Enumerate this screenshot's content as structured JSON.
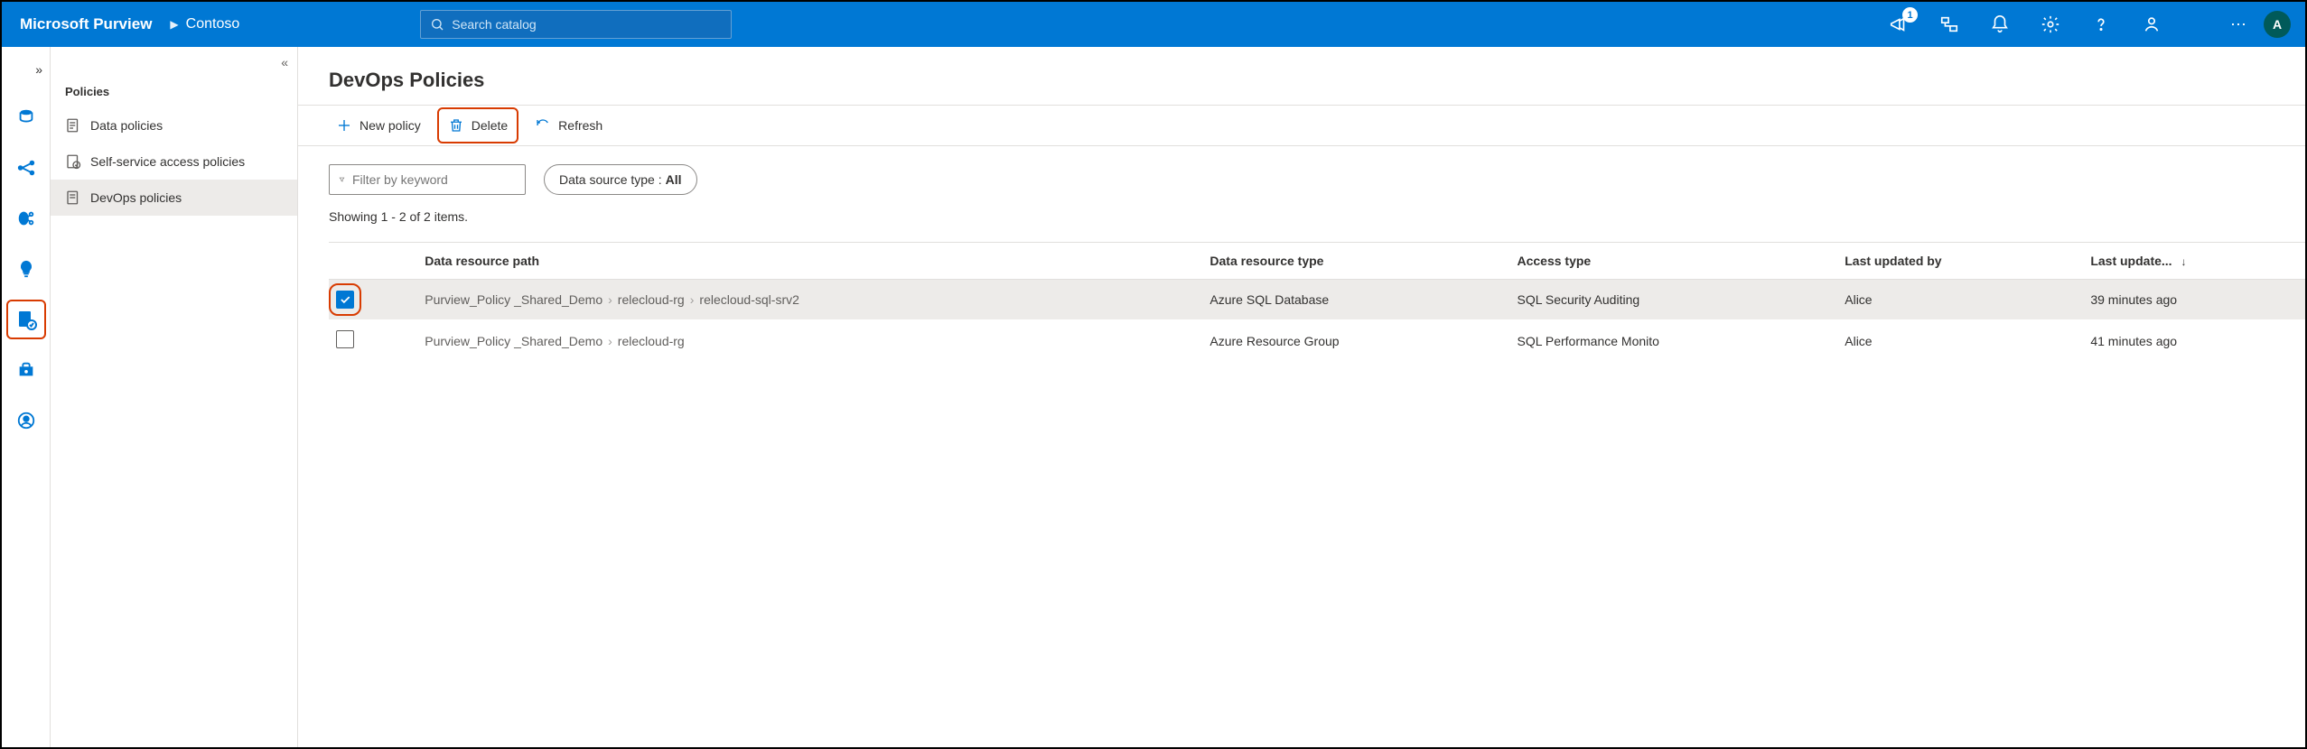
{
  "header": {
    "app_title": "Microsoft Purview",
    "breadcrumb": "Contoso",
    "search_placeholder": "Search catalog",
    "notification_count": "1",
    "avatar_initial": "A"
  },
  "sidebar": {
    "title": "Policies",
    "items": [
      {
        "label": "Data policies",
        "icon": "data-policies-icon"
      },
      {
        "label": "Self-service access policies",
        "icon": "self-service-icon"
      },
      {
        "label": "DevOps policies",
        "icon": "devops-policies-icon",
        "selected": true
      }
    ]
  },
  "page": {
    "title": "DevOps Policies",
    "commands": {
      "new_label": "New policy",
      "delete_label": "Delete",
      "refresh_label": "Refresh"
    },
    "filter_placeholder": "Filter by keyword",
    "source_type_label": "Data source type :",
    "source_type_value": "All",
    "count_line": "Showing 1 - 2 of 2 items.",
    "columns": {
      "path": "Data resource path",
      "type": "Data resource type",
      "access": "Access type",
      "user": "Last updated by",
      "updated": "Last update..."
    },
    "rows": [
      {
        "checked": true,
        "path": [
          "Purview_Policy _Shared_Demo",
          "relecloud-rg",
          "relecloud-sql-srv2"
        ],
        "type": "Azure SQL Database",
        "access": "SQL Security Auditing",
        "user": "Alice",
        "updated": "39 minutes ago"
      },
      {
        "checked": false,
        "path": [
          "Purview_Policy _Shared_Demo",
          "relecloud-rg"
        ],
        "type": "Azure Resource Group",
        "access": "SQL Performance Monito",
        "user": "Alice",
        "updated": "41 minutes ago"
      }
    ]
  }
}
